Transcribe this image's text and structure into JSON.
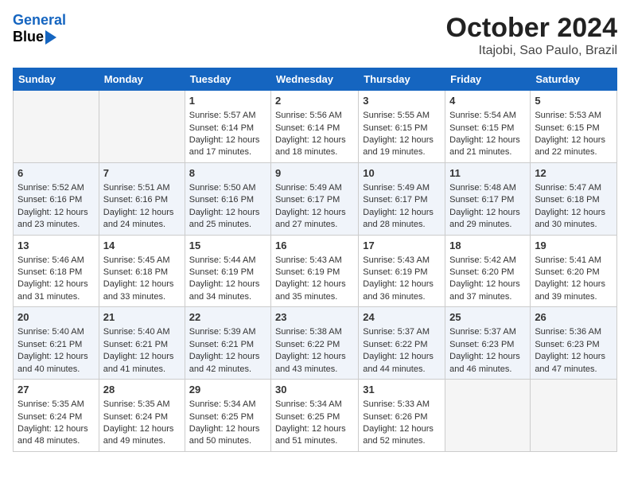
{
  "header": {
    "logo_line1": "General",
    "logo_line2": "Blue",
    "title": "October 2024",
    "subtitle": "Itajobi, Sao Paulo, Brazil"
  },
  "days_of_week": [
    "Sunday",
    "Monday",
    "Tuesday",
    "Wednesday",
    "Thursday",
    "Friday",
    "Saturday"
  ],
  "weeks": [
    [
      {
        "day": "",
        "info": ""
      },
      {
        "day": "",
        "info": ""
      },
      {
        "day": "1",
        "info": "Sunrise: 5:57 AM\nSunset: 6:14 PM\nDaylight: 12 hours and 17 minutes."
      },
      {
        "day": "2",
        "info": "Sunrise: 5:56 AM\nSunset: 6:14 PM\nDaylight: 12 hours and 18 minutes."
      },
      {
        "day": "3",
        "info": "Sunrise: 5:55 AM\nSunset: 6:15 PM\nDaylight: 12 hours and 19 minutes."
      },
      {
        "day": "4",
        "info": "Sunrise: 5:54 AM\nSunset: 6:15 PM\nDaylight: 12 hours and 21 minutes."
      },
      {
        "day": "5",
        "info": "Sunrise: 5:53 AM\nSunset: 6:15 PM\nDaylight: 12 hours and 22 minutes."
      }
    ],
    [
      {
        "day": "6",
        "info": "Sunrise: 5:52 AM\nSunset: 6:16 PM\nDaylight: 12 hours and 23 minutes."
      },
      {
        "day": "7",
        "info": "Sunrise: 5:51 AM\nSunset: 6:16 PM\nDaylight: 12 hours and 24 minutes."
      },
      {
        "day": "8",
        "info": "Sunrise: 5:50 AM\nSunset: 6:16 PM\nDaylight: 12 hours and 25 minutes."
      },
      {
        "day": "9",
        "info": "Sunrise: 5:49 AM\nSunset: 6:17 PM\nDaylight: 12 hours and 27 minutes."
      },
      {
        "day": "10",
        "info": "Sunrise: 5:49 AM\nSunset: 6:17 PM\nDaylight: 12 hours and 28 minutes."
      },
      {
        "day": "11",
        "info": "Sunrise: 5:48 AM\nSunset: 6:17 PM\nDaylight: 12 hours and 29 minutes."
      },
      {
        "day": "12",
        "info": "Sunrise: 5:47 AM\nSunset: 6:18 PM\nDaylight: 12 hours and 30 minutes."
      }
    ],
    [
      {
        "day": "13",
        "info": "Sunrise: 5:46 AM\nSunset: 6:18 PM\nDaylight: 12 hours and 31 minutes."
      },
      {
        "day": "14",
        "info": "Sunrise: 5:45 AM\nSunset: 6:18 PM\nDaylight: 12 hours and 33 minutes."
      },
      {
        "day": "15",
        "info": "Sunrise: 5:44 AM\nSunset: 6:19 PM\nDaylight: 12 hours and 34 minutes."
      },
      {
        "day": "16",
        "info": "Sunrise: 5:43 AM\nSunset: 6:19 PM\nDaylight: 12 hours and 35 minutes."
      },
      {
        "day": "17",
        "info": "Sunrise: 5:43 AM\nSunset: 6:19 PM\nDaylight: 12 hours and 36 minutes."
      },
      {
        "day": "18",
        "info": "Sunrise: 5:42 AM\nSunset: 6:20 PM\nDaylight: 12 hours and 37 minutes."
      },
      {
        "day": "19",
        "info": "Sunrise: 5:41 AM\nSunset: 6:20 PM\nDaylight: 12 hours and 39 minutes."
      }
    ],
    [
      {
        "day": "20",
        "info": "Sunrise: 5:40 AM\nSunset: 6:21 PM\nDaylight: 12 hours and 40 minutes."
      },
      {
        "day": "21",
        "info": "Sunrise: 5:40 AM\nSunset: 6:21 PM\nDaylight: 12 hours and 41 minutes."
      },
      {
        "day": "22",
        "info": "Sunrise: 5:39 AM\nSunset: 6:21 PM\nDaylight: 12 hours and 42 minutes."
      },
      {
        "day": "23",
        "info": "Sunrise: 5:38 AM\nSunset: 6:22 PM\nDaylight: 12 hours and 43 minutes."
      },
      {
        "day": "24",
        "info": "Sunrise: 5:37 AM\nSunset: 6:22 PM\nDaylight: 12 hours and 44 minutes."
      },
      {
        "day": "25",
        "info": "Sunrise: 5:37 AM\nSunset: 6:23 PM\nDaylight: 12 hours and 46 minutes."
      },
      {
        "day": "26",
        "info": "Sunrise: 5:36 AM\nSunset: 6:23 PM\nDaylight: 12 hours and 47 minutes."
      }
    ],
    [
      {
        "day": "27",
        "info": "Sunrise: 5:35 AM\nSunset: 6:24 PM\nDaylight: 12 hours and 48 minutes."
      },
      {
        "day": "28",
        "info": "Sunrise: 5:35 AM\nSunset: 6:24 PM\nDaylight: 12 hours and 49 minutes."
      },
      {
        "day": "29",
        "info": "Sunrise: 5:34 AM\nSunset: 6:25 PM\nDaylight: 12 hours and 50 minutes."
      },
      {
        "day": "30",
        "info": "Sunrise: 5:34 AM\nSunset: 6:25 PM\nDaylight: 12 hours and 51 minutes."
      },
      {
        "day": "31",
        "info": "Sunrise: 5:33 AM\nSunset: 6:26 PM\nDaylight: 12 hours and 52 minutes."
      },
      {
        "day": "",
        "info": ""
      },
      {
        "day": "",
        "info": ""
      }
    ]
  ]
}
